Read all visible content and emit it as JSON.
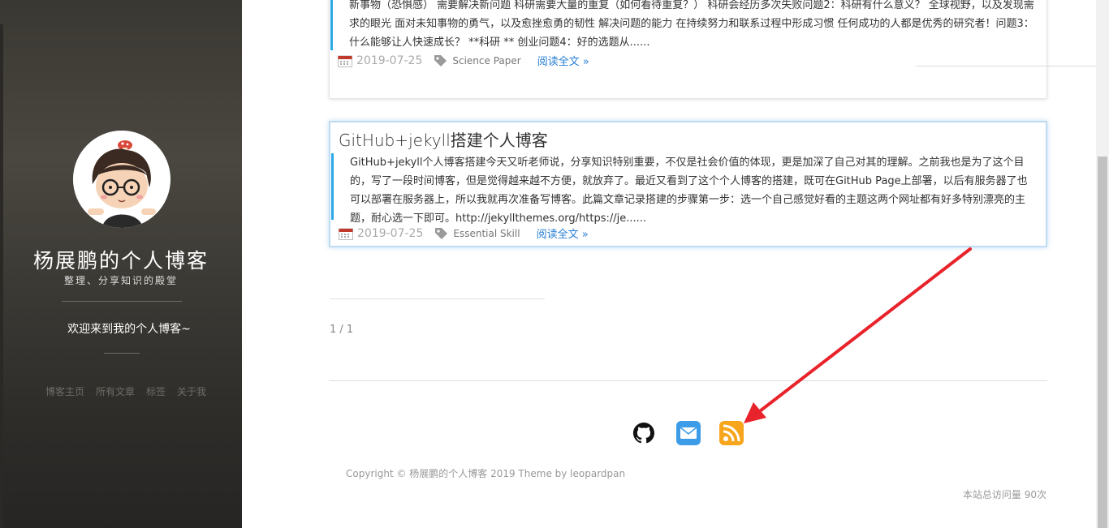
{
  "sidebar": {
    "title": "杨展鹏的个人博客",
    "subtitle": "整理、分享知识的殿堂",
    "welcome": "欢迎来到我的个人博客~",
    "nav": [
      "博客主页",
      "所有文章",
      "标签",
      "关于我"
    ]
  },
  "posts": [
    {
      "excerpt": "新事物（恐惧感） 需要解决新问题 科研需要大量的重复（如何看待重复？） 科研会经历多次失败问题2：科研有什么意义？ 全球视野，以及发现需求的眼光 面对未知事物的勇气，以及愈挫愈勇的韧性 解决问题的能力 在持续努力和联系过程中形成习惯 任何成功的人都是优秀的研究者！问题3：什么能够让人快速成长？ **科研 ** 创业问题4：好的选题从......",
      "date": "2019-07-25",
      "tag": "Science Paper",
      "read_more": "阅读全文 »"
    },
    {
      "title": "GitHub+jekyll搭建个人博客",
      "excerpt": "GitHub+jekyll个人博客搭建今天又听老师说，分享知识特别重要，不仅是社会价值的体现，更是加深了自己对其的理解。之前我也是为了这个目的，写了一段时间博客，但是觉得越来越不方便，就放弃了。最近又看到了这个个人博客的搭建，既可在GitHub Page上部署，以后有服务器了也可以部署在服务器上，所以我就再次准备写博客。此篇文章记录搭建的步骤第一步：选一个自己感觉好看的主题这两个网址都有好多特别漂亮的主题，耐心选一下即可。http://jekyllthemes.org/https://je......",
      "date": "2019-07-25",
      "tag": "Essential Skill",
      "read_more": "阅读全文 »"
    }
  ],
  "pager": "1 / 1",
  "social": [
    {
      "icon": "github-icon"
    },
    {
      "icon": "email-icon"
    },
    {
      "icon": "rss-icon"
    }
  ],
  "footer": {
    "copyright": "Copyright © 杨展鹏的个人博客 2019 Theme by leopardpan",
    "visits": "本站总访问量 90次"
  },
  "colors": {
    "accent": "#2ca8e6",
    "link": "#2a7fd4",
    "annotation_arrow": "#e8232b",
    "rss": "#f7a51c"
  }
}
